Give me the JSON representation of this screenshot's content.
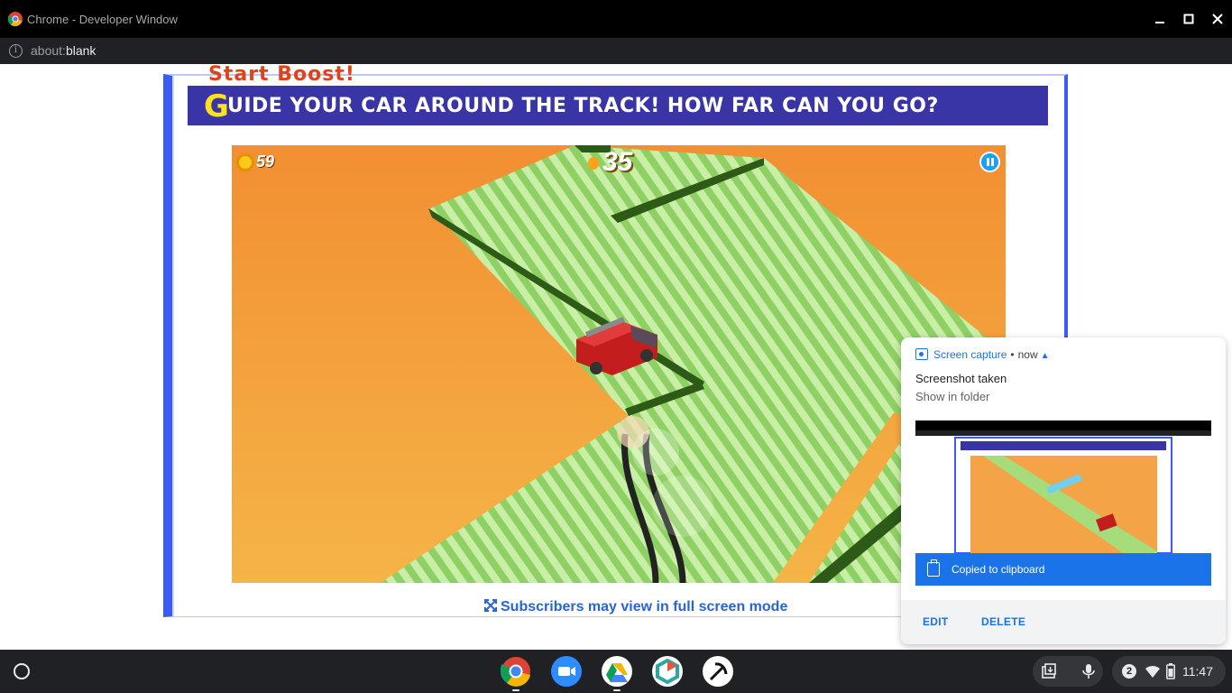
{
  "window": {
    "title": "Chrome - Developer Window"
  },
  "addressbar": {
    "scheme": "about:",
    "path": "blank"
  },
  "page": {
    "cut_heading": "Start Boost!",
    "banner": {
      "first_letter": "G",
      "text": "uide your car around the track! How far can you go?"
    },
    "game": {
      "coins": "59",
      "score": "35"
    },
    "fullscreen_link": "Subscribers may view in full screen mode"
  },
  "notification": {
    "source": "Screen capture",
    "separator": "•",
    "time": "now",
    "title": "Screenshot taken",
    "subtitle": "Show in folder",
    "clipboard_label": "Copied to clipboard",
    "actions": {
      "edit": "EDIT",
      "delete": "DELETE"
    }
  },
  "shelf": {
    "apps": [
      "chrome-icon",
      "zoom-icon",
      "drive-icon",
      "photopea-icon",
      "pickaxe-icon"
    ],
    "notification_count": "2",
    "clock": "11:47"
  },
  "colors": {
    "frame_border": "#3b5cf2",
    "banner_bg": "#3a35a6",
    "sky_orange": "#f3943a",
    "track_green": "#a7dc7c",
    "accent_blue": "#1a73e8"
  }
}
